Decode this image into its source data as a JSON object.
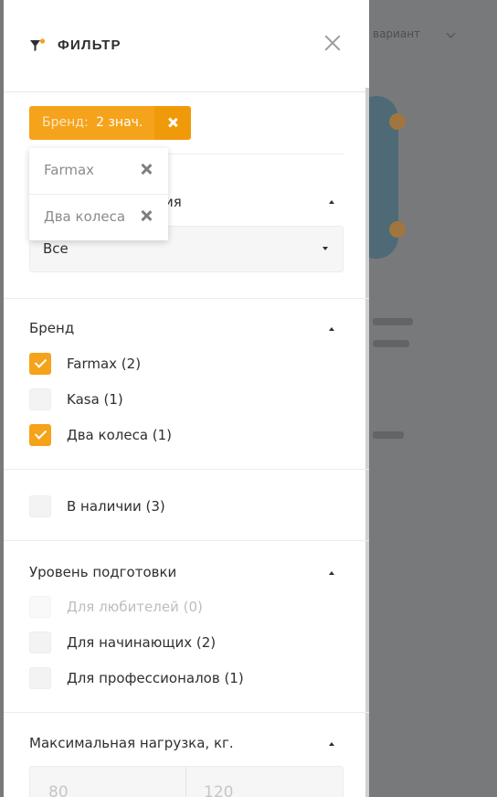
{
  "backdrop": {
    "sort_label": "вариант"
  },
  "header": {
    "title": "ФИЛЬТР",
    "icon": "filter-icon",
    "close_icon": "close-icon"
  },
  "active_filter_chip": {
    "label": "Бренд:",
    "value": "2 знач.",
    "remove_icon": "close-icon",
    "accent": "#f5a31a"
  },
  "chip_popover": {
    "items": [
      {
        "label": "Farmax"
      },
      {
        "label": "Два колеса"
      }
    ]
  },
  "category_section": {
    "title_suffix": "ия",
    "select_value": "Все"
  },
  "brand_section": {
    "title": "Бренд",
    "options": [
      {
        "label": "Farmax (2)",
        "checked": true
      },
      {
        "label": "Kasa (1)",
        "checked": false
      },
      {
        "label": "Два колеса (1)",
        "checked": true
      }
    ]
  },
  "stock_section": {
    "option": {
      "label": "В наличии (3)",
      "checked": false
    }
  },
  "level_section": {
    "title": "Уровень подготовки",
    "options": [
      {
        "label": "Для любителей (0)",
        "checked": false,
        "disabled": true
      },
      {
        "label": "Для начинающих (2)",
        "checked": false,
        "disabled": false
      },
      {
        "label": "Для профессионалов (1)",
        "checked": false,
        "disabled": false
      }
    ]
  },
  "load_section": {
    "title": "Максимальная нагрузка, кг.",
    "min": "80",
    "max": "120"
  }
}
